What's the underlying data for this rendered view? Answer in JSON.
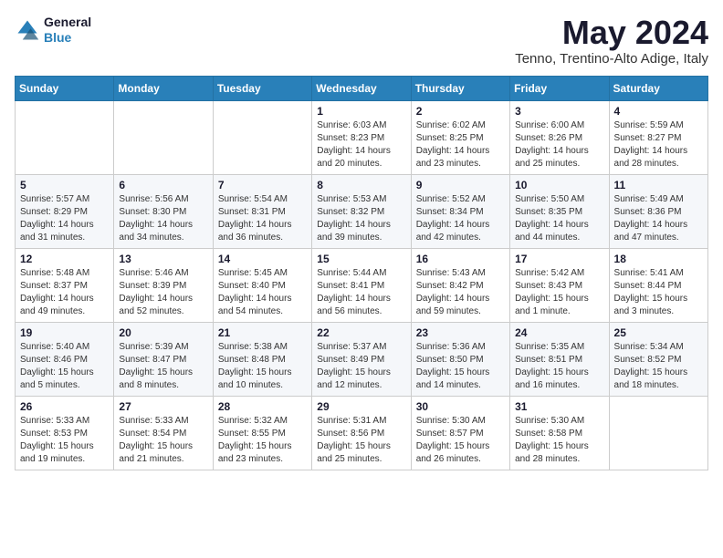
{
  "header": {
    "logo_line1": "General",
    "logo_line2": "Blue",
    "month_year": "May 2024",
    "location": "Tenno, Trentino-Alto Adige, Italy"
  },
  "weekdays": [
    "Sunday",
    "Monday",
    "Tuesday",
    "Wednesday",
    "Thursday",
    "Friday",
    "Saturday"
  ],
  "weeks": [
    [
      {
        "day": "",
        "detail": ""
      },
      {
        "day": "",
        "detail": ""
      },
      {
        "day": "",
        "detail": ""
      },
      {
        "day": "1",
        "detail": "Sunrise: 6:03 AM\nSunset: 8:23 PM\nDaylight: 14 hours\nand 20 minutes."
      },
      {
        "day": "2",
        "detail": "Sunrise: 6:02 AM\nSunset: 8:25 PM\nDaylight: 14 hours\nand 23 minutes."
      },
      {
        "day": "3",
        "detail": "Sunrise: 6:00 AM\nSunset: 8:26 PM\nDaylight: 14 hours\nand 25 minutes."
      },
      {
        "day": "4",
        "detail": "Sunrise: 5:59 AM\nSunset: 8:27 PM\nDaylight: 14 hours\nand 28 minutes."
      }
    ],
    [
      {
        "day": "5",
        "detail": "Sunrise: 5:57 AM\nSunset: 8:29 PM\nDaylight: 14 hours\nand 31 minutes."
      },
      {
        "day": "6",
        "detail": "Sunrise: 5:56 AM\nSunset: 8:30 PM\nDaylight: 14 hours\nand 34 minutes."
      },
      {
        "day": "7",
        "detail": "Sunrise: 5:54 AM\nSunset: 8:31 PM\nDaylight: 14 hours\nand 36 minutes."
      },
      {
        "day": "8",
        "detail": "Sunrise: 5:53 AM\nSunset: 8:32 PM\nDaylight: 14 hours\nand 39 minutes."
      },
      {
        "day": "9",
        "detail": "Sunrise: 5:52 AM\nSunset: 8:34 PM\nDaylight: 14 hours\nand 42 minutes."
      },
      {
        "day": "10",
        "detail": "Sunrise: 5:50 AM\nSunset: 8:35 PM\nDaylight: 14 hours\nand 44 minutes."
      },
      {
        "day": "11",
        "detail": "Sunrise: 5:49 AM\nSunset: 8:36 PM\nDaylight: 14 hours\nand 47 minutes."
      }
    ],
    [
      {
        "day": "12",
        "detail": "Sunrise: 5:48 AM\nSunset: 8:37 PM\nDaylight: 14 hours\nand 49 minutes."
      },
      {
        "day": "13",
        "detail": "Sunrise: 5:46 AM\nSunset: 8:39 PM\nDaylight: 14 hours\nand 52 minutes."
      },
      {
        "day": "14",
        "detail": "Sunrise: 5:45 AM\nSunset: 8:40 PM\nDaylight: 14 hours\nand 54 minutes."
      },
      {
        "day": "15",
        "detail": "Sunrise: 5:44 AM\nSunset: 8:41 PM\nDaylight: 14 hours\nand 56 minutes."
      },
      {
        "day": "16",
        "detail": "Sunrise: 5:43 AM\nSunset: 8:42 PM\nDaylight: 14 hours\nand 59 minutes."
      },
      {
        "day": "17",
        "detail": "Sunrise: 5:42 AM\nSunset: 8:43 PM\nDaylight: 15 hours\nand 1 minute."
      },
      {
        "day": "18",
        "detail": "Sunrise: 5:41 AM\nSunset: 8:44 PM\nDaylight: 15 hours\nand 3 minutes."
      }
    ],
    [
      {
        "day": "19",
        "detail": "Sunrise: 5:40 AM\nSunset: 8:46 PM\nDaylight: 15 hours\nand 5 minutes."
      },
      {
        "day": "20",
        "detail": "Sunrise: 5:39 AM\nSunset: 8:47 PM\nDaylight: 15 hours\nand 8 minutes."
      },
      {
        "day": "21",
        "detail": "Sunrise: 5:38 AM\nSunset: 8:48 PM\nDaylight: 15 hours\nand 10 minutes."
      },
      {
        "day": "22",
        "detail": "Sunrise: 5:37 AM\nSunset: 8:49 PM\nDaylight: 15 hours\nand 12 minutes."
      },
      {
        "day": "23",
        "detail": "Sunrise: 5:36 AM\nSunset: 8:50 PM\nDaylight: 15 hours\nand 14 minutes."
      },
      {
        "day": "24",
        "detail": "Sunrise: 5:35 AM\nSunset: 8:51 PM\nDaylight: 15 hours\nand 16 minutes."
      },
      {
        "day": "25",
        "detail": "Sunrise: 5:34 AM\nSunset: 8:52 PM\nDaylight: 15 hours\nand 18 minutes."
      }
    ],
    [
      {
        "day": "26",
        "detail": "Sunrise: 5:33 AM\nSunset: 8:53 PM\nDaylight: 15 hours\nand 19 minutes."
      },
      {
        "day": "27",
        "detail": "Sunrise: 5:33 AM\nSunset: 8:54 PM\nDaylight: 15 hours\nand 21 minutes."
      },
      {
        "day": "28",
        "detail": "Sunrise: 5:32 AM\nSunset: 8:55 PM\nDaylight: 15 hours\nand 23 minutes."
      },
      {
        "day": "29",
        "detail": "Sunrise: 5:31 AM\nSunset: 8:56 PM\nDaylight: 15 hours\nand 25 minutes."
      },
      {
        "day": "30",
        "detail": "Sunrise: 5:30 AM\nSunset: 8:57 PM\nDaylight: 15 hours\nand 26 minutes."
      },
      {
        "day": "31",
        "detail": "Sunrise: 5:30 AM\nSunset: 8:58 PM\nDaylight: 15 hours\nand 28 minutes."
      },
      {
        "day": "",
        "detail": ""
      }
    ]
  ]
}
